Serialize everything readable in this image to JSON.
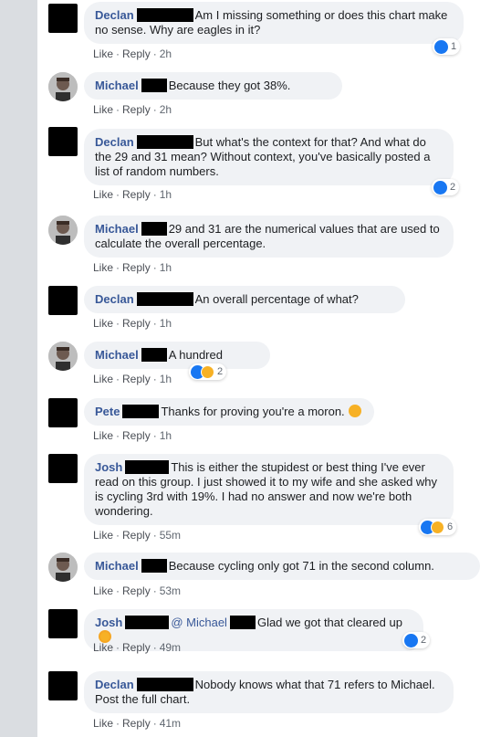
{
  "actions": {
    "like": "Like",
    "reply": "Reply",
    "sep": "·"
  },
  "comments": [
    {
      "name": "Declan",
      "text": "Am I missing something or does this chart make no sense. Why are eagles in it?",
      "time": "2h",
      "reaction_count": "1"
    },
    {
      "name": "Michael",
      "text": "Because they got 38%.",
      "time": "2h"
    },
    {
      "name": "Declan",
      "text": "But what's the context for that? And what do the 29 and 31 mean? Without context, you've basically posted a list of random numbers.",
      "time": "1h",
      "reaction_count": "2"
    },
    {
      "name": "Michael",
      "text": "29 and 31 are the numerical values that are used to calculate the overall percentage.",
      "time": "1h"
    },
    {
      "name": "Declan",
      "text": "An overall percentage of what?",
      "time": "1h"
    },
    {
      "name": "Michael",
      "text": "A hundred",
      "time": "1h",
      "reaction_count": "2"
    },
    {
      "name": "Pete",
      "text": "Thanks for proving you're a moron.",
      "time": "1h"
    },
    {
      "name": "Josh",
      "text": "This is either the stupidest or best thing I've ever read on this group. I just showed it to my wife and she asked why is cycling 3rd with 19%. I had no answer and now we're both wondering.",
      "time": "55m",
      "reaction_count": "6"
    },
    {
      "name": "Michael",
      "text": "Because cycling only got 71 in the second column.",
      "time": "53m"
    },
    {
      "name": "Josh",
      "mention": "@ Michael",
      "text": "Glad we got that cleared up",
      "time": "49m",
      "reaction_count": "2"
    },
    {
      "name": "Declan",
      "text": "Nobody knows what that 71 refers to Michael. Post the full chart.",
      "time": "41m"
    }
  ],
  "colors": {
    "name_blue": "#385898",
    "bubble_bg": "#f0f2f5",
    "like_blue": "#1877f2",
    "haha_yellow": "#f7b125"
  }
}
